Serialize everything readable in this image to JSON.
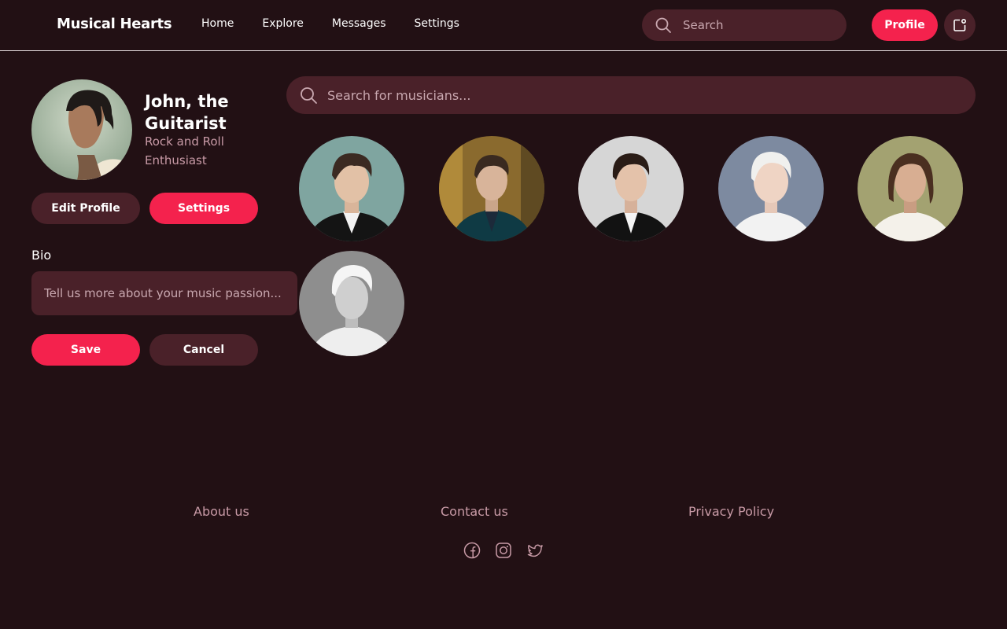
{
  "app": {
    "brand": "Musical Hearts"
  },
  "nav": {
    "links": [
      {
        "label": "Home"
      },
      {
        "label": "Explore"
      },
      {
        "label": "Messages"
      },
      {
        "label": "Settings"
      }
    ],
    "search_placeholder": "Search",
    "profile_label": "Profile",
    "notification_icon": "notification-icon"
  },
  "profile": {
    "name": "John, the Guitarist",
    "tagline": "Rock and Roll Enthusiast",
    "edit_label": "Edit Profile",
    "settings_label": "Settings",
    "bio_label": "Bio",
    "bio_placeholder": "Tell us more about your music passion...",
    "save_label": "Save",
    "cancel_label": "Cancel"
  },
  "musicians": {
    "search_placeholder": "Search for musicians..."
  },
  "footer": {
    "links": [
      {
        "label": "About us"
      },
      {
        "label": "Contact us"
      },
      {
        "label": "Privacy Policy"
      }
    ],
    "social": [
      "facebook-icon",
      "instagram-icon",
      "twitter-icon"
    ]
  },
  "colors": {
    "background": "#221014",
    "surface": "#4a2129",
    "accent": "#f4224d",
    "muted_text": "#c89aa6"
  }
}
